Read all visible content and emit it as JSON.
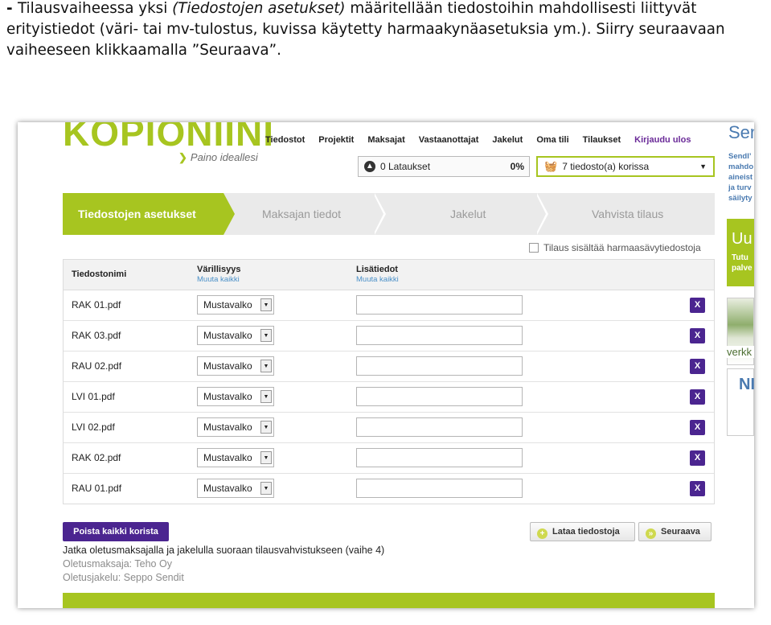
{
  "intro": {
    "dash": "- ",
    "step_name": "Tilausvaiheessa yksi",
    "italic": "(Tiedostojen asetukset)",
    "rest": " määritellään tiedostoihin mahdollisesti liittyvät erityistiedot (väri- tai mv-tulostus, kuvissa käytetty harmaakynäasetuksia ym.).  Siirry seuraavaan vaiheeseen klikkaamalla ”Seuraava”."
  },
  "header": {
    "logo": "KOPIONIINI",
    "tagline": "Paino ideallesi",
    "nav": [
      "Tiedostot",
      "Projektit",
      "Maksajat",
      "Vastaanottajat",
      "Jakelut",
      "Oma tili",
      "Tilaukset",
      "Kirjaudu ulos"
    ],
    "uploads_label": "0 Lataukset",
    "uploads_percent": "0%",
    "cart_label": "7 tiedosto(a) korissa"
  },
  "steps": [
    "Tiedostojen asetukset",
    "Maksajan tiedot",
    "Jakelut",
    "Vahvista tilaus"
  ],
  "grayscale_label": "Tilaus sisältää harmaasävytiedostoja",
  "table": {
    "col_filename": "Tiedostonimi",
    "col_color": "Värillisyys",
    "col_color_link": "Muuta kaikki",
    "col_extra": "Lisätiedot",
    "col_extra_link": "Muuta kaikki",
    "remove_label": "X",
    "rows": [
      {
        "file": "RAK 01.pdf",
        "color": "Mustavalko"
      },
      {
        "file": "RAK 03.pdf",
        "color": "Mustavalko"
      },
      {
        "file": "RAU 02.pdf",
        "color": "Mustavalko"
      },
      {
        "file": "LVI 01.pdf",
        "color": "Mustavalko"
      },
      {
        "file": "LVI 02.pdf",
        "color": "Mustavalko"
      },
      {
        "file": "RAK 02.pdf",
        "color": "Mustavalko"
      },
      {
        "file": "RAU 01.pdf",
        "color": "Mustavalko"
      }
    ]
  },
  "actions": {
    "remove_all": "Poista kaikki korista",
    "upload": "Lataa tiedostoja",
    "next": "Seuraava",
    "continue_text": "Jatka oletusmaksajalla ja jakelulla suoraan tilausvahvistukseen (vaihe 4)",
    "default_payer": "Oletusmaksaja: Teho Oy",
    "default_delivery": "Oletusjakelu: Seppo Sendit"
  },
  "sidebar": {
    "heading": "Sen",
    "text": "SendI’ mahdo aineist ja turv säilyty",
    "promo_title": "Uu",
    "promo_text": "Tutu palve",
    "image_caption": "verkk",
    "box_title": "NI"
  },
  "colors": {
    "accent": "#a7c520",
    "purple": "#4b2590"
  }
}
